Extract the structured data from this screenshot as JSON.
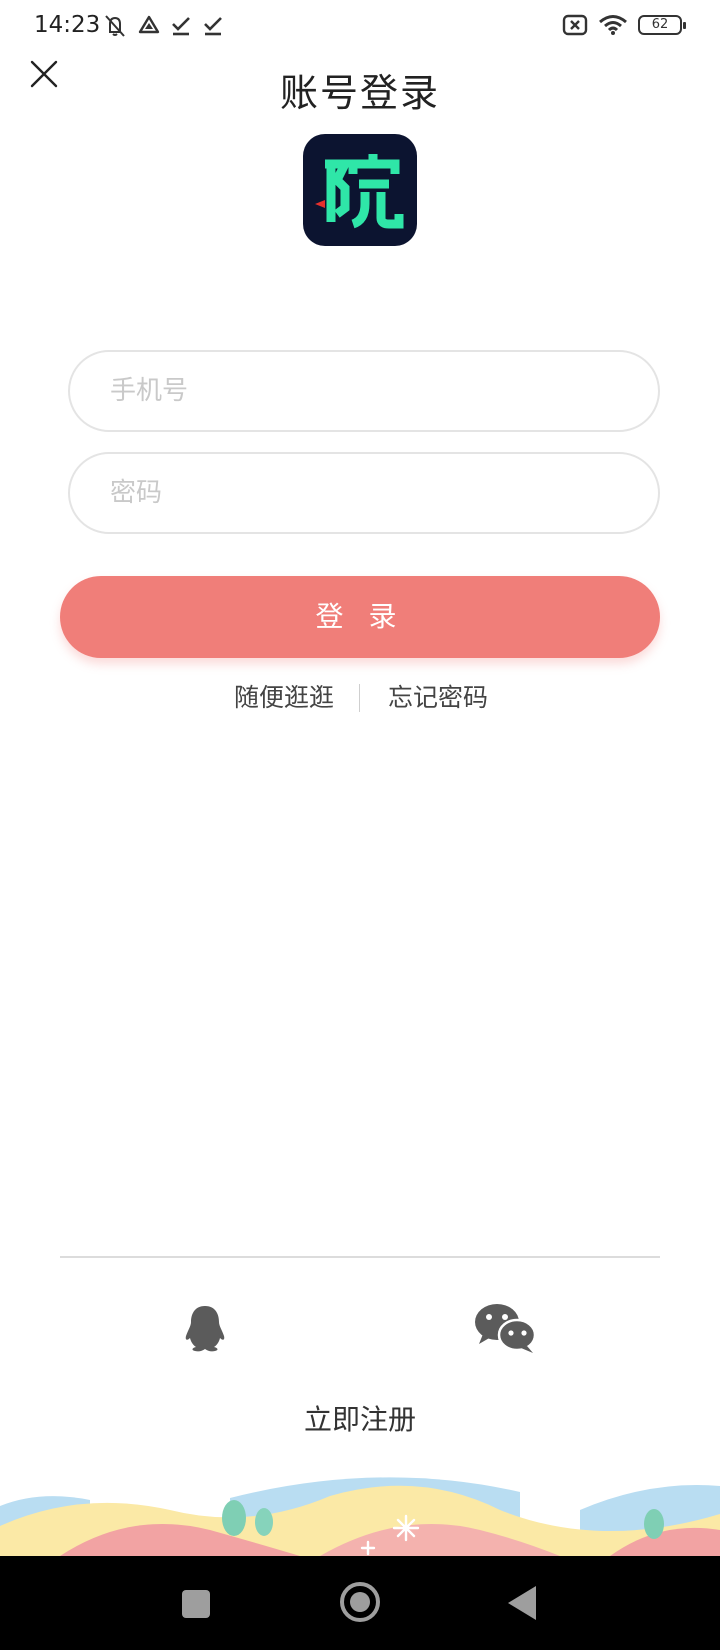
{
  "status_bar": {
    "time": "14:23",
    "battery": "62",
    "left_icons": [
      "mute-icon",
      "triangle-icon",
      "check-icon",
      "check-icon"
    ],
    "right_icons": [
      "no-sim-icon",
      "wifi-icon",
      "battery-icon"
    ]
  },
  "header": {
    "title": "账号登录",
    "close_icon": "close-icon"
  },
  "logo": {
    "glyph": "院",
    "background": "#0c1430",
    "glyph_color": "#2fe6a8",
    "accent_color": "#e6302c"
  },
  "form": {
    "phone_placeholder": "手机号",
    "phone_value": "",
    "password_placeholder": "密码",
    "password_value": "",
    "login_label": "登 录",
    "login_color": "#f07e79"
  },
  "links": {
    "browse": "随便逛逛",
    "forgot_password": "忘记密码"
  },
  "social": {
    "qq_icon": "qq-icon",
    "wechat_icon": "wechat-icon"
  },
  "footer": {
    "register": "立即注册"
  },
  "nav_bar": {
    "recent_icon": "square-icon",
    "home_icon": "circle-icon",
    "back_icon": "triangle-back-icon"
  }
}
